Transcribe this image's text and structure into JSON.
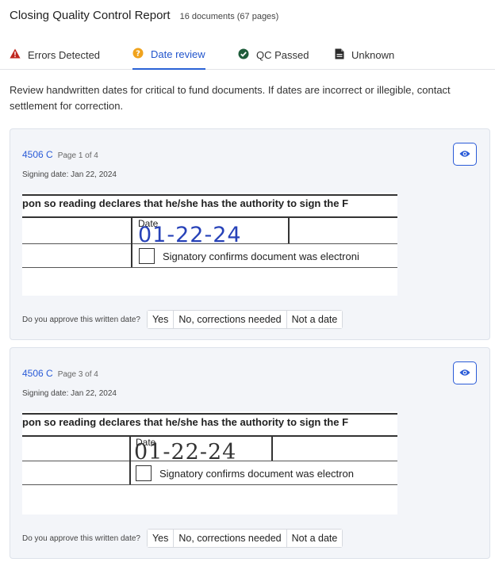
{
  "header": {
    "title": "Closing Quality Control Report",
    "subtitle": "16 documents (67 pages)"
  },
  "tabs": [
    {
      "label": "Errors Detected",
      "icon": "warning-triangle-icon",
      "color": "#c0271f"
    },
    {
      "label": "Date review",
      "icon": "question-circle-icon",
      "color": "#f0a31d",
      "active": true
    },
    {
      "label": "QC Passed",
      "icon": "check-circle-icon",
      "color": "#1e5c3a"
    },
    {
      "label": "Unknown",
      "icon": "document-icon",
      "color": "#2b2b2b"
    }
  ],
  "description": "Review handwritten dates for critical to fund documents. If dates are incorrect or illegible, contact settlement for correction.",
  "cards": [
    {
      "doc_name": "4506 C",
      "page_label": "Page 1 of 4",
      "signing_date": "Signing date: Jan 22, 2024",
      "snippet": {
        "line_text": "pon so reading declares that he/she has the authority to sign the F",
        "date_label": "Date",
        "handwritten_date": "01-22-24",
        "checkbox_text": "Signatory confirms document was electroni"
      },
      "approve_question": "Do you approve this written date?",
      "buttons": [
        "Yes",
        "No, corrections needed",
        "Not a date"
      ]
    },
    {
      "doc_name": "4506 C",
      "page_label": "Page 3 of 4",
      "signing_date": "Signing date: Jan 22, 2024",
      "snippet": {
        "line_text": "pon so reading declares that he/she has the authority to sign the F",
        "date_label": "Date",
        "handwritten_date": "01-22-24",
        "checkbox_text": "Signatory confirms document was electron"
      },
      "approve_question": "Do you approve this written date?",
      "buttons": [
        "Yes",
        "No, corrections needed",
        "Not a date"
      ]
    }
  ]
}
